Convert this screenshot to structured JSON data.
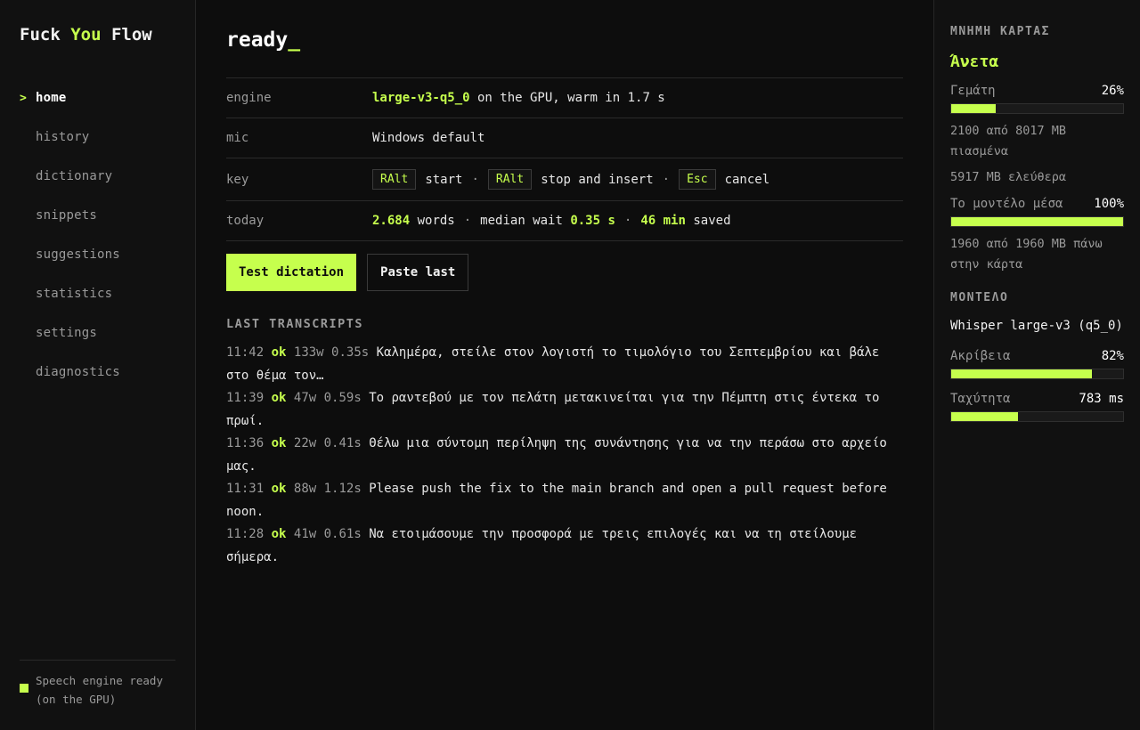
{
  "brand": {
    "part1": "Fuck ",
    "part2": "You",
    "part3": " Flow"
  },
  "nav": [
    {
      "label": "home",
      "active": true
    },
    {
      "label": "history"
    },
    {
      "label": "dictionary"
    },
    {
      "label": "snippets"
    },
    {
      "label": "suggestions"
    },
    {
      "label": "statistics"
    },
    {
      "label": "settings"
    },
    {
      "label": "diagnostics"
    }
  ],
  "status": {
    "text": "Speech engine ready (on the GPU)",
    "color": "#c6ff4d"
  },
  "main": {
    "title": "ready",
    "cursor": "_",
    "rows": {
      "engine": {
        "label": "engine",
        "model": "large-v3-q5_0",
        "rest": " on the GPU, warm in 1.7 s"
      },
      "mic": {
        "label": "mic",
        "value": "Windows default"
      },
      "key": {
        "label": "key",
        "start_key": "RAlt",
        "start_label": "start",
        "stop_key": "RAlt",
        "stop_label": "stop and insert",
        "cancel_key": "Esc",
        "cancel_label": "cancel",
        "sep": "·"
      },
      "today": {
        "label": "today",
        "words": "2.684",
        "words_label": " words",
        "sep": "·",
        "wait_label": "median wait ",
        "wait": "0.35 s",
        "saved": "46 min",
        "saved_label": " saved"
      }
    },
    "buttons": {
      "test": "Test dictation",
      "paste": "Paste last"
    },
    "transcripts_heading": "LAST TRANSCRIPTS",
    "transcripts": [
      {
        "time": "11:42",
        "status": "ok",
        "words": "133w",
        "wait": "0.35s",
        "text": "Καλημέρα, στείλε στον λογιστή το τιμολόγιο του Σεπτεμβρίου και βάλε στο θέμα τον…"
      },
      {
        "time": "11:39",
        "status": "ok",
        "words": "47w",
        "wait": "0.59s",
        "text": "Το ραντεβού με τον πελάτη μετακινείται για την Πέμπτη στις έντεκα το πρωί."
      },
      {
        "time": "11:36",
        "status": "ok",
        "words": "22w",
        "wait": "0.41s",
        "text": "Θέλω μια σύντομη περίληψη της συνάντησης για να την περάσω στο αρχείο μας."
      },
      {
        "time": "11:31",
        "status": "ok",
        "words": "88w",
        "wait": "1.12s",
        "text": "Please push the fix to the main branch and open a pull request before noon."
      },
      {
        "time": "11:28",
        "status": "ok",
        "words": "41w",
        "wait": "0.61s",
        "text": "Να ετοιμάσουμε την προσφορά με τρεις επιλογές και να τη στείλουμε σήμερα."
      }
    ]
  },
  "panel": {
    "mem_heading": "ΜΝΗΜΗ ΚΑΡΤΑΣ",
    "mem_state": "Άνετα",
    "full_label": "Γεμάτη",
    "full_value": "26%",
    "full_fraction": 0.26,
    "used_note": "2100 από 8017 MB πιασμένα",
    "free_note": "5917 MB ελεύθερα",
    "model_in_label": "Το μοντέλο μέσα",
    "model_in_value": "100%",
    "model_in_fraction": 1.0,
    "model_in_note": "1960 από 1960 MB πάνω στην κάρτα",
    "model_heading": "ΜΟΝΤΕΛΟ",
    "model_name": "Whisper large-v3 (q5_0)",
    "accuracy_label": "Ακρίβεια",
    "accuracy_value": "82%",
    "accuracy_fraction": 0.82,
    "speed_label": "Ταχύτητα",
    "speed_value": "783 ms",
    "speed_fraction": 0.39
  },
  "colors": {
    "accent": "#c6ff4d",
    "bg": "#0d0d0d",
    "muted": "#9a9a9a"
  }
}
